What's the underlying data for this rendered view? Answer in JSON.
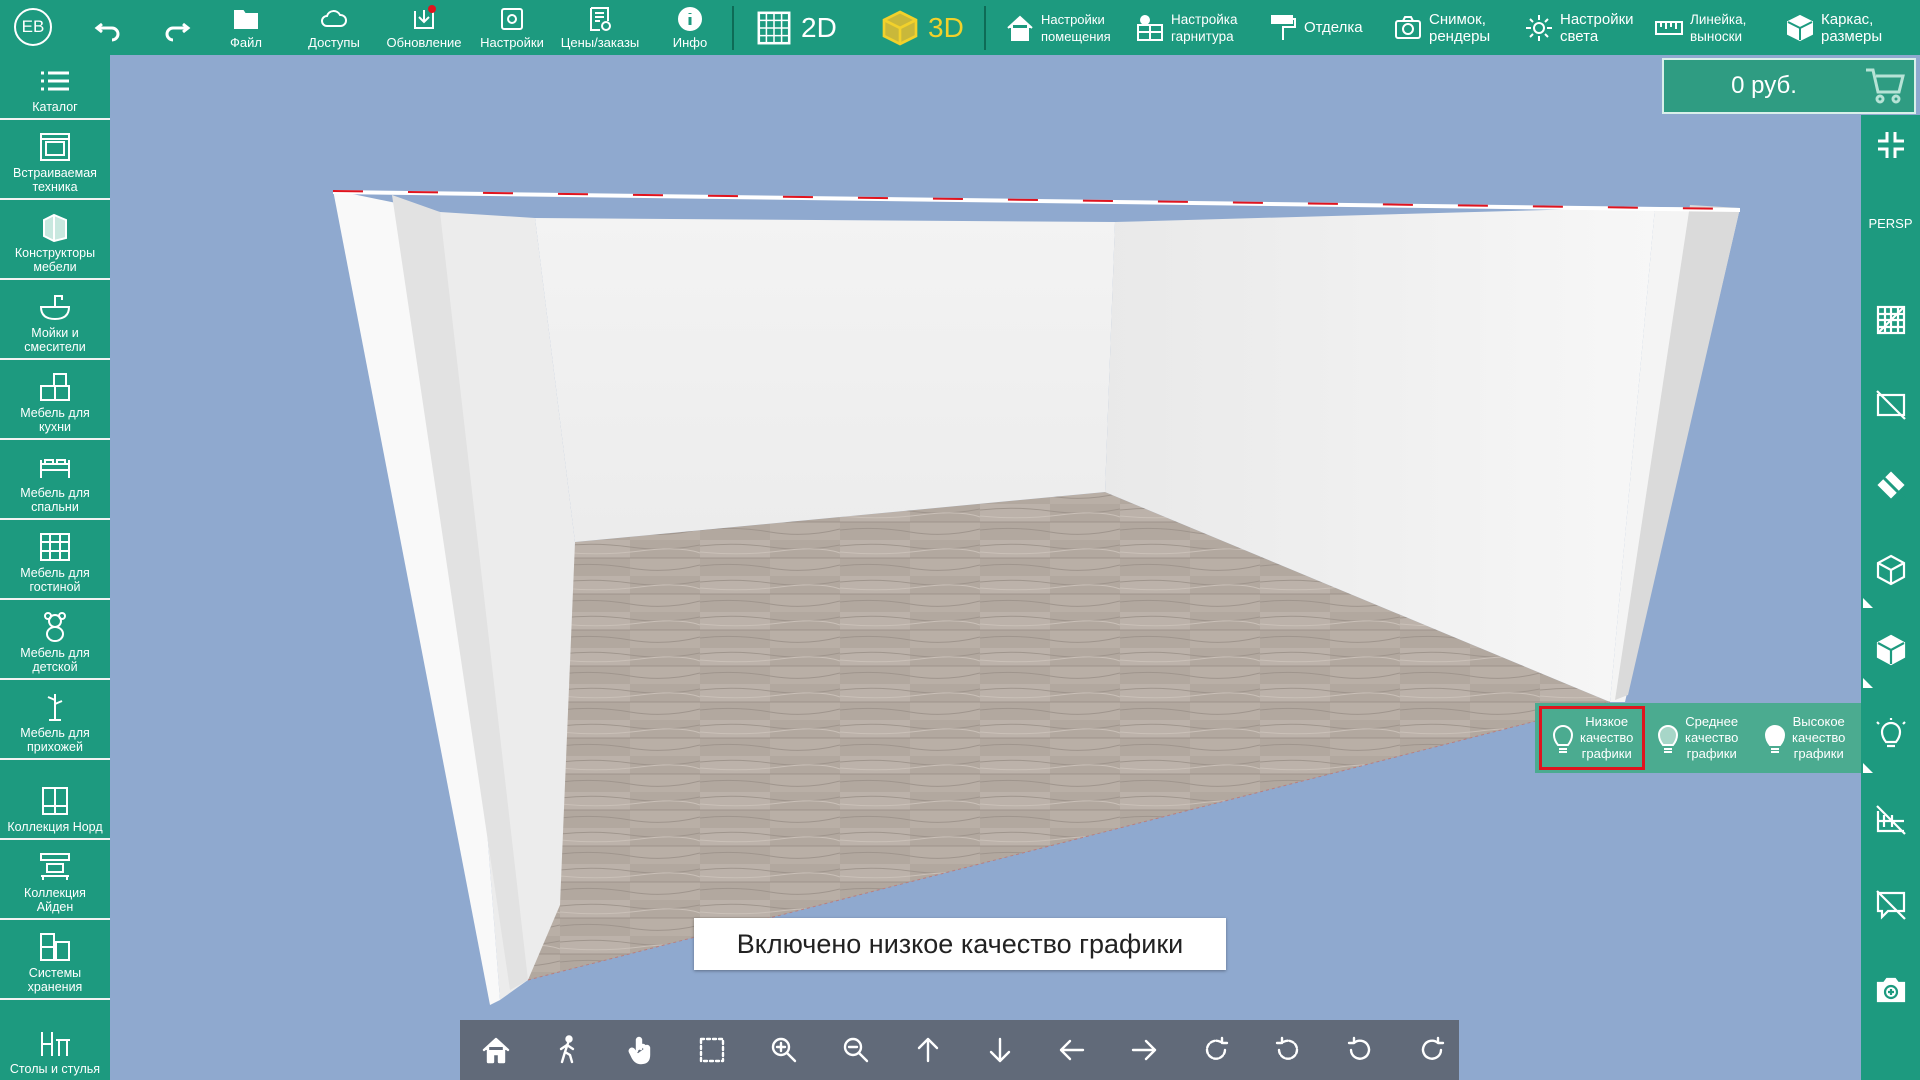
{
  "colors": {
    "toolbar": "#1d9a7f",
    "accent_3d": "#f2d12b",
    "viewport_bg": "#8fa9cf",
    "selection": "#e0141e"
  },
  "user": {
    "initials": "ЕВ"
  },
  "topbar": {
    "file": "Файл",
    "access": "Доступы",
    "update": "Обновление",
    "settings": "Настройки",
    "prices": "Цены/заказы",
    "info": "Инфо",
    "mode_2d": "2D",
    "mode_3d": "3D",
    "room_settings": "Настройки\nпомещения",
    "set_settings": "Настройка\nгарнитура",
    "finish": "Отделка",
    "snapshot": "Снимок,\nрендеры",
    "light": "Настройки\nсвета",
    "ruler": "Линейка,\nвыноски",
    "frame": "Каркас,\nразмеры"
  },
  "cart": {
    "price": "0 руб."
  },
  "sidebar": {
    "items": [
      {
        "label": "Каталог",
        "icon": "list-icon"
      },
      {
        "label": "Встраиваемая\nтехника",
        "icon": "oven-icon"
      },
      {
        "label": "Конструкторы\nмебели",
        "icon": "constructor-icon"
      },
      {
        "label": "Мойки и\nсмесители",
        "icon": "sink-icon"
      },
      {
        "label": "Мебель для\nкухни",
        "icon": "kitchen-icon"
      },
      {
        "label": "Мебель для\nспальни",
        "icon": "bed-icon"
      },
      {
        "label": "Мебель для\nгостиной",
        "icon": "living-icon"
      },
      {
        "label": "Мебель для\nдетской",
        "icon": "teddy-icon"
      },
      {
        "label": "Мебель для\nприхожей",
        "icon": "hanger-icon"
      },
      {
        "label": "Коллекция Норд",
        "icon": "cabinet-icon"
      },
      {
        "label": "Коллекция\nАйден",
        "icon": "shelf-icon"
      },
      {
        "label": "Системы\nхранения",
        "icon": "storage-icon"
      },
      {
        "label": "Столы и стулья",
        "icon": "table-chair-icon"
      }
    ]
  },
  "rightbar": {
    "persp": "PERSP"
  },
  "quality": {
    "low": "Низкое\nкачество\nграфики",
    "medium": "Среднее\nкачество\nграфики",
    "high": "Высокое\nкачество\nграфики"
  },
  "toast": {
    "message": "Включено низкое качество графики"
  }
}
